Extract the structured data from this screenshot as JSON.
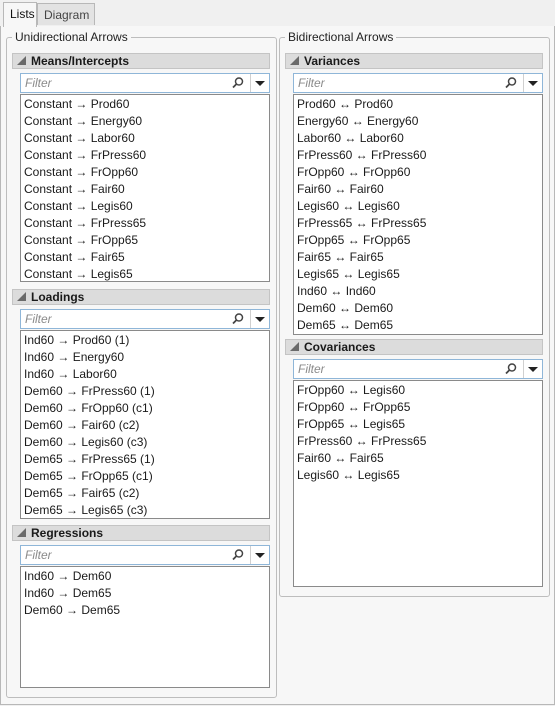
{
  "tabs": [
    {
      "label": "Lists"
    },
    {
      "label": "Diagram"
    }
  ],
  "unidirectional": {
    "title": "Unidirectional Arrows",
    "means": {
      "title": "Means/Intercepts",
      "filter_placeholder": "Filter",
      "items": [
        "Constant → Prod60",
        "Constant → Energy60",
        "Constant → Labor60",
        "Constant → FrPress60",
        "Constant → FrOpp60",
        "Constant → Fair60",
        "Constant → Legis60",
        "Constant → FrPress65",
        "Constant → FrOpp65",
        "Constant → Fair65",
        "Constant → Legis65"
      ]
    },
    "loadings": {
      "title": "Loadings",
      "filter_placeholder": "Filter",
      "items": [
        "Ind60 → Prod60 (1)",
        "Ind60 → Energy60",
        "Ind60 → Labor60",
        "Dem60 → FrPress60 (1)",
        "Dem60 → FrOpp60 (c1)",
        "Dem60 → Fair60 (c2)",
        "Dem60 → Legis60 (c3)",
        "Dem65 → FrPress65 (1)",
        "Dem65 → FrOpp65 (c1)",
        "Dem65 → Fair65 (c2)",
        "Dem65 → Legis65 (c3)"
      ]
    },
    "regressions": {
      "title": "Regressions",
      "filter_placeholder": "Filter",
      "items": [
        "Ind60 → Dem60",
        "Ind60 → Dem65",
        "Dem60 → Dem65"
      ]
    }
  },
  "bidirectional": {
    "title": "Bidirectional Arrows",
    "variances": {
      "title": "Variances",
      "filter_placeholder": "Filter",
      "items": [
        "Prod60 ↔ Prod60",
        "Energy60 ↔ Energy60",
        "Labor60 ↔ Labor60",
        "FrPress60 ↔ FrPress60",
        "FrOpp60 ↔ FrOpp60",
        "Fair60 ↔ Fair60",
        "Legis60 ↔ Legis60",
        "FrPress65 ↔ FrPress65",
        "FrOpp65 ↔ FrOpp65",
        "Fair65 ↔ Fair65",
        "Legis65 ↔ Legis65",
        "Ind60 ↔ Ind60",
        "Dem60 ↔ Dem60",
        "Dem65 ↔ Dem65"
      ]
    },
    "covariances": {
      "title": "Covariances",
      "filter_placeholder": "Filter",
      "items": [
        "FrOpp60 ↔ Legis60",
        "FrOpp60 ↔ FrOpp65",
        "FrOpp65 ↔ Legis65",
        "FrPress60 ↔ FrPress65",
        "Fair60 ↔ Fair65",
        "Legis60 ↔ Legis65"
      ]
    }
  },
  "icons": {
    "filter_search": "search-icon",
    "filter_menu": "dropdown-arrow-icon",
    "section_toggle": "disclosure-triangle-icon"
  }
}
